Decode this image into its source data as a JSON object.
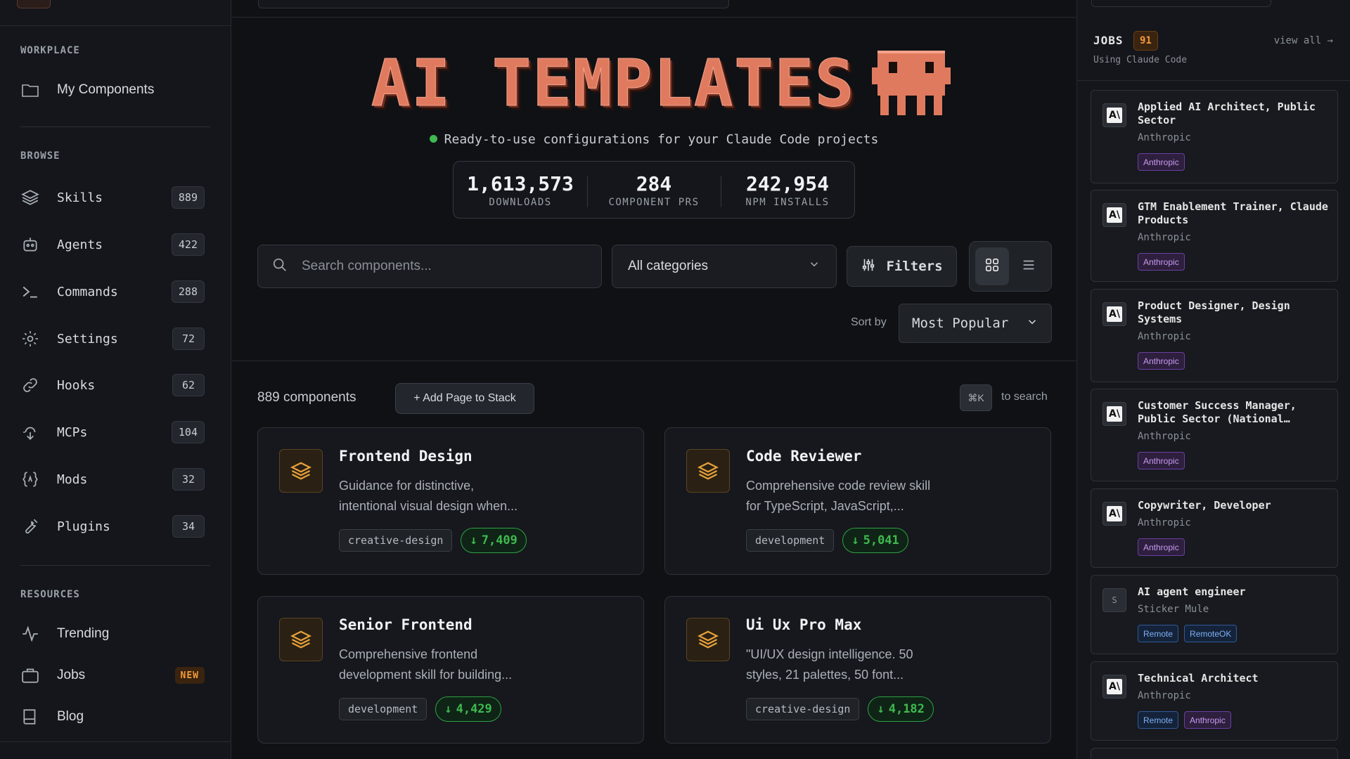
{
  "sidebar": {
    "sections": {
      "workplace": "WORKPLACE",
      "browse": "BROWSE",
      "resources": "RESOURCES"
    },
    "workplace_items": [
      {
        "label": "My Components",
        "icon": "folder-icon"
      }
    ],
    "browse_items": [
      {
        "label": "Skills",
        "count": "889",
        "icon": "layers-icon"
      },
      {
        "label": "Agents",
        "count": "422",
        "icon": "bot-icon"
      },
      {
        "label": "Commands",
        "count": "288",
        "icon": "terminal-icon"
      },
      {
        "label": "Settings",
        "count": "72",
        "icon": "gear-icon"
      },
      {
        "label": "Hooks",
        "count": "62",
        "icon": "link-icon"
      },
      {
        "label": "MCPs",
        "count": "104",
        "icon": "plug-icon"
      },
      {
        "label": "Mods",
        "count": "32",
        "icon": "braces-icon"
      },
      {
        "label": "Plugins",
        "count": "34",
        "icon": "wrench-icon"
      }
    ],
    "resource_items": [
      {
        "label": "Trending",
        "icon": "activity-icon"
      },
      {
        "label": "Jobs",
        "badge": "NEW",
        "icon": "briefcase-icon"
      },
      {
        "label": "Blog",
        "icon": "book-icon"
      }
    ]
  },
  "hero": {
    "title": "AI TEMPLATES",
    "tagline": "Ready-to-use configurations for your Claude Code projects",
    "stats": [
      {
        "value": "1,613,573",
        "label": "DOWNLOADS"
      },
      {
        "value": "284",
        "label": "COMPONENT PRS"
      },
      {
        "value": "242,954",
        "label": "NPM INSTALLS"
      }
    ]
  },
  "toolbar": {
    "search_placeholder": "Search components...",
    "category": "All categories",
    "filters_label": "Filters",
    "sort_label": "Sort by",
    "sort_value": "Most Popular"
  },
  "results": {
    "count_text": "889 components",
    "add_stack": "+ Add Page to Stack",
    "kbd": "⌘K",
    "kbd_hint": "to search"
  },
  "cards": [
    {
      "title": "Frontend Design",
      "desc": "Guidance for distinctive, intentional visual design when...",
      "tag": "creative-design",
      "downloads": "7,409"
    },
    {
      "title": "Code Reviewer",
      "desc": "Comprehensive code review skill for TypeScript, JavaScript,...",
      "tag": "development",
      "downloads": "5,041"
    },
    {
      "title": "Senior Frontend",
      "desc": "Comprehensive frontend development skill for building...",
      "tag": "development",
      "downloads": "4,429"
    },
    {
      "title": "Ui Ux Pro Max",
      "desc": "\"UI/UX design intelligence. 50 styles, 21 palettes, 50 font...",
      "tag": "creative-design",
      "downloads": "4,182"
    }
  ],
  "jobs": {
    "title": "JOBS",
    "count": "91",
    "subtitle": "Using Claude Code",
    "view_all": "view all →",
    "items": [
      {
        "title": "Applied AI Architect, Public Sector",
        "company": "Anthropic",
        "logo": "A\\",
        "tags": [
          {
            "label": "Anthropic",
            "color": "purple"
          }
        ]
      },
      {
        "title": "GTM Enablement Trainer, Claude Products",
        "company": "Anthropic",
        "logo": "A\\",
        "tags": [
          {
            "label": "Anthropic",
            "color": "purple"
          }
        ]
      },
      {
        "title": "Product Designer, Design Systems",
        "company": "Anthropic",
        "logo": "A\\",
        "tags": [
          {
            "label": "Anthropic",
            "color": "purple"
          }
        ]
      },
      {
        "title": "Customer Success Manager, Public Sector (National…",
        "company": "Anthropic",
        "logo": "A\\",
        "tags": [
          {
            "label": "Anthropic",
            "color": "purple"
          }
        ]
      },
      {
        "title": "Copywriter, Developer",
        "company": "Anthropic",
        "logo": "A\\",
        "tags": [
          {
            "label": "Anthropic",
            "color": "purple"
          }
        ]
      },
      {
        "title": "AI agent engineer",
        "company": "Sticker Mule",
        "logo": "S",
        "tags": [
          {
            "label": "Remote",
            "color": "blue"
          },
          {
            "label": "RemoteOK",
            "color": "blue"
          }
        ]
      },
      {
        "title": "Technical Architect",
        "company": "Anthropic",
        "logo": "A\\",
        "tags": [
          {
            "label": "Remote",
            "color": "blue"
          },
          {
            "label": "Anthropic",
            "color": "purple"
          }
        ]
      }
    ]
  },
  "colors": {
    "accent": "#e07a5f",
    "download_green": "#3fb950",
    "badge_orange": "#f29a3a"
  }
}
